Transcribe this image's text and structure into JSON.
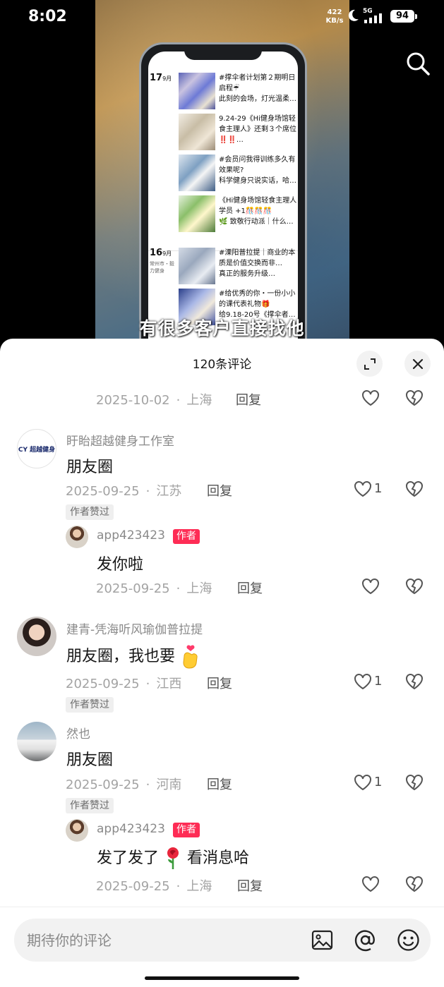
{
  "status_bar": {
    "time": "8:02",
    "net_speed_value": "422",
    "net_speed_unit": "KB/s",
    "signal_label": "5G",
    "battery": "94"
  },
  "video": {
    "subtitle": "有很多客户直接找他",
    "moments": [
      {
        "day": "17",
        "month": "9月",
        "location": "",
        "text": "#撑伞者计划第２期明日\n启程☔\n此刻的会场，灯光温柔…"
      },
      {
        "day": "",
        "month": "",
        "location": "",
        "text": "9.24-29《Hi健身场馆轻\n食主理人》还剩３个席位\n‼️‼️…"
      },
      {
        "day": "",
        "month": "",
        "location": "",
        "text": "#会员问我得训练多久有\n效果呢?\n科学健身只说实话，哈…"
      },
      {
        "day": "",
        "month": "",
        "location": "",
        "text": "《Hi健身场馆轻食主理人\n学员 +1🎊🎊🎊\n🌿 致敬行动派｜什么…"
      },
      {
        "day": "16",
        "month": "9月",
        "location": "常州市・毅力健身",
        "text": "#溧阳普拉提｜商业的本\n质是价值交换而非…\n真正的服务升级…"
      },
      {
        "day": "",
        "month": "",
        "location": "",
        "text": "#给优秀的你・一份小小\n的课代表礼物🎁\n给9.18-20号《撑伞者…"
      }
    ]
  },
  "comments_panel": {
    "title": "120条评论",
    "top_row": {
      "date": "2025-10-02",
      "location": "上海",
      "reply_label": "回复"
    },
    "comments": [
      {
        "avatar_text": "CY 超越健身",
        "name": "盱眙超越健身工作室",
        "text": "朋友圈",
        "date": "2025-09-25",
        "location": "江苏",
        "reply_label": "回复",
        "likes": "1",
        "tag": "作者赞过",
        "reply": {
          "name": "app423423",
          "badge": "作者",
          "text": "发你啦",
          "date": "2025-09-25",
          "location": "上海",
          "reply_label": "回复"
        }
      },
      {
        "name": "建青-凭海听风瑜伽普拉提",
        "text": "朋友圈，我也要",
        "date": "2025-09-25",
        "location": "江西",
        "reply_label": "回复",
        "likes": "1",
        "tag": "作者赞过"
      },
      {
        "name": "然也",
        "text": "朋友圈",
        "date": "2025-09-25",
        "location": "河南",
        "reply_label": "回复",
        "likes": "1",
        "tag": "作者赞过",
        "reply": {
          "name": "app423423",
          "badge": "作者",
          "text_before": "发了发了",
          "text_after": "看消息哈",
          "date": "2025-09-25",
          "location": "上海",
          "reply_label": "回复"
        }
      }
    ],
    "input_placeholder": "期待你的评论"
  },
  "icons": {
    "search": "search-icon",
    "expand": "expand-icon",
    "close": "close-icon",
    "like": "heart-icon",
    "dislike": "broken-heart-icon",
    "image": "image-icon",
    "mention": "at-icon",
    "emoji": "smiley-icon"
  },
  "colors": {
    "author_badge": "#fe2c55",
    "sheet_bg": "#ffffff",
    "meta_text": "#a3a3a3"
  }
}
